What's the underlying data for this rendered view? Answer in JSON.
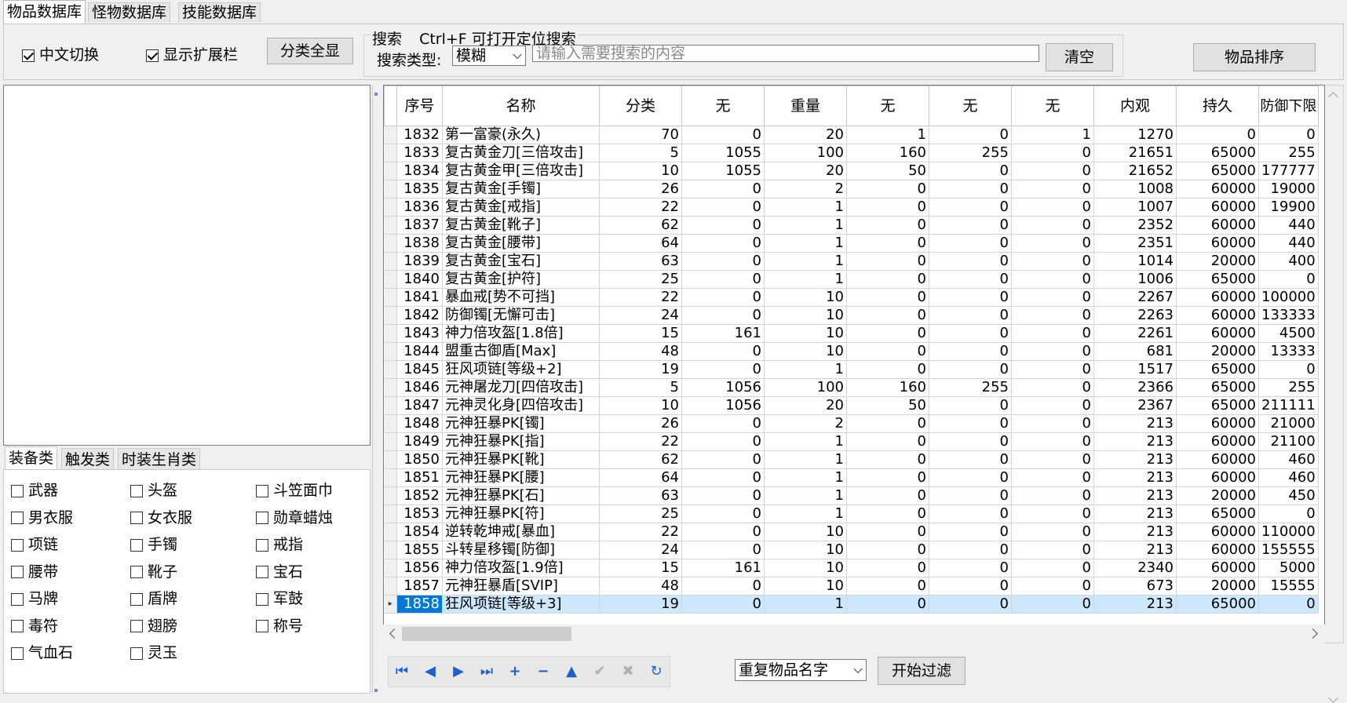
{
  "top_tabs": [
    "物品数据库",
    "怪物数据库",
    "技能数据库"
  ],
  "options": {
    "chinese_toggle": {
      "label": "中文切换",
      "checked": true
    },
    "show_ext": {
      "label": "显示扩展栏",
      "checked": true
    },
    "show_all_label": "分类全显"
  },
  "search": {
    "group_title": "搜索",
    "hint": "Ctrl+F 可打开定位搜索",
    "type_label": "搜索类型:",
    "type_value": "模糊",
    "placeholder": "请输入需要搜索的内容",
    "clear_label": "清空"
  },
  "sort_label": "物品排序",
  "category_tabs": [
    "装备类",
    "触发类",
    "时装生肖类"
  ],
  "categories": [
    [
      "武器",
      "头盔",
      "斗笠面巾"
    ],
    [
      "男衣服",
      "女衣服",
      "勋章蜡烛"
    ],
    [
      "项链",
      "手镯",
      "戒指"
    ],
    [
      "腰带",
      "靴子",
      "宝石"
    ],
    [
      "马牌",
      "盾牌",
      "军鼓"
    ],
    [
      "毒符",
      "翅膀",
      "称号"
    ],
    [
      "气血石",
      "灵玉",
      ""
    ]
  ],
  "grid": {
    "columns": [
      "序号",
      "名称",
      "分类",
      "无",
      "重量",
      "无",
      "无",
      "无",
      "内观",
      "持久",
      "防御下限"
    ],
    "rows": [
      [
        "1832",
        "第一富豪(永久)",
        "70",
        "0",
        "20",
        "1",
        "0",
        "1",
        "1270",
        "0",
        "0"
      ],
      [
        "1833",
        "复古黄金刀[三倍攻击]",
        "5",
        "1055",
        "100",
        "160",
        "255",
        "0",
        "21651",
        "65000",
        "255"
      ],
      [
        "1834",
        "复古黄金甲[三倍攻击]",
        "10",
        "1055",
        "20",
        "50",
        "0",
        "0",
        "21652",
        "65000",
        "177777"
      ],
      [
        "1835",
        "复古黄金[手镯]",
        "26",
        "0",
        "2",
        "0",
        "0",
        "0",
        "1008",
        "60000",
        "19000"
      ],
      [
        "1836",
        "复古黄金[戒指]",
        "22",
        "0",
        "1",
        "0",
        "0",
        "0",
        "1007",
        "60000",
        "19900"
      ],
      [
        "1837",
        "复古黄金[靴子]",
        "62",
        "0",
        "1",
        "0",
        "0",
        "0",
        "2352",
        "60000",
        "440"
      ],
      [
        "1838",
        "复古黄金[腰带]",
        "64",
        "0",
        "1",
        "0",
        "0",
        "0",
        "2351",
        "60000",
        "440"
      ],
      [
        "1839",
        "复古黄金[宝石]",
        "63",
        "0",
        "1",
        "0",
        "0",
        "0",
        "1014",
        "20000",
        "400"
      ],
      [
        "1840",
        "复古黄金[护符]",
        "25",
        "0",
        "1",
        "0",
        "0",
        "0",
        "1006",
        "65000",
        "0"
      ],
      [
        "1841",
        "暴血戒[势不可挡]",
        "22",
        "0",
        "10",
        "0",
        "0",
        "0",
        "2267",
        "60000",
        "100000"
      ],
      [
        "1842",
        "防御镯[无懈可击]",
        "24",
        "0",
        "10",
        "0",
        "0",
        "0",
        "2263",
        "60000",
        "133333"
      ],
      [
        "1843",
        "神力倍攻盔[1.8倍]",
        "15",
        "161",
        "10",
        "0",
        "0",
        "0",
        "2261",
        "60000",
        "4500"
      ],
      [
        "1844",
        "盟重古御盾[Max]",
        "48",
        "0",
        "10",
        "0",
        "0",
        "0",
        "681",
        "20000",
        "13333"
      ],
      [
        "1845",
        "狂风项链[等级+2]",
        "19",
        "0",
        "1",
        "0",
        "0",
        "0",
        "1517",
        "65000",
        "0"
      ],
      [
        "1846",
        "元神屠龙刀[四倍攻击]",
        "5",
        "1056",
        "100",
        "160",
        "255",
        "0",
        "2366",
        "65000",
        "255"
      ],
      [
        "1847",
        "元神灵化身[四倍攻击]",
        "10",
        "1056",
        "20",
        "50",
        "0",
        "0",
        "2367",
        "65000",
        "211111"
      ],
      [
        "1848",
        "元神狂暴PK[镯]",
        "26",
        "0",
        "2",
        "0",
        "0",
        "0",
        "213",
        "60000",
        "21000"
      ],
      [
        "1849",
        "元神狂暴PK[指]",
        "22",
        "0",
        "1",
        "0",
        "0",
        "0",
        "213",
        "60000",
        "21100"
      ],
      [
        "1850",
        "元神狂暴PK[靴]",
        "62",
        "0",
        "1",
        "0",
        "0",
        "0",
        "213",
        "60000",
        "460"
      ],
      [
        "1851",
        "元神狂暴PK[腰]",
        "64",
        "0",
        "1",
        "0",
        "0",
        "0",
        "213",
        "60000",
        "460"
      ],
      [
        "1852",
        "元神狂暴PK[石]",
        "63",
        "0",
        "1",
        "0",
        "0",
        "0",
        "213",
        "20000",
        "450"
      ],
      [
        "1853",
        "元神狂暴PK[符]",
        "25",
        "0",
        "1",
        "0",
        "0",
        "0",
        "213",
        "65000",
        "0"
      ],
      [
        "1854",
        "逆转乾坤戒[暴血]",
        "22",
        "0",
        "10",
        "0",
        "0",
        "0",
        "213",
        "60000",
        "110000"
      ],
      [
        "1855",
        "斗转星移镯[防御]",
        "24",
        "0",
        "10",
        "0",
        "0",
        "0",
        "213",
        "60000",
        "155555"
      ],
      [
        "1856",
        "神力倍攻盔[1.9倍]",
        "15",
        "161",
        "10",
        "0",
        "0",
        "0",
        "2340",
        "60000",
        "5000"
      ],
      [
        "1857",
        "元神狂暴盾[SVIP]",
        "48",
        "0",
        "10",
        "0",
        "0",
        "0",
        "673",
        "20000",
        "15555"
      ],
      [
        "1858",
        "狂风项链[等级+3]",
        "19",
        "0",
        "1",
        "0",
        "0",
        "0",
        "213",
        "65000",
        "0"
      ]
    ],
    "selected_row": 26
  },
  "filter": {
    "select_value": "重复物品名字",
    "button_label": "开始过滤"
  },
  "navigator_icons": [
    "first-icon",
    "prior-icon",
    "next-icon",
    "last-icon",
    "insert-icon",
    "delete-icon",
    "edit-icon",
    "post-icon",
    "cancel-icon",
    "refresh-icon"
  ]
}
